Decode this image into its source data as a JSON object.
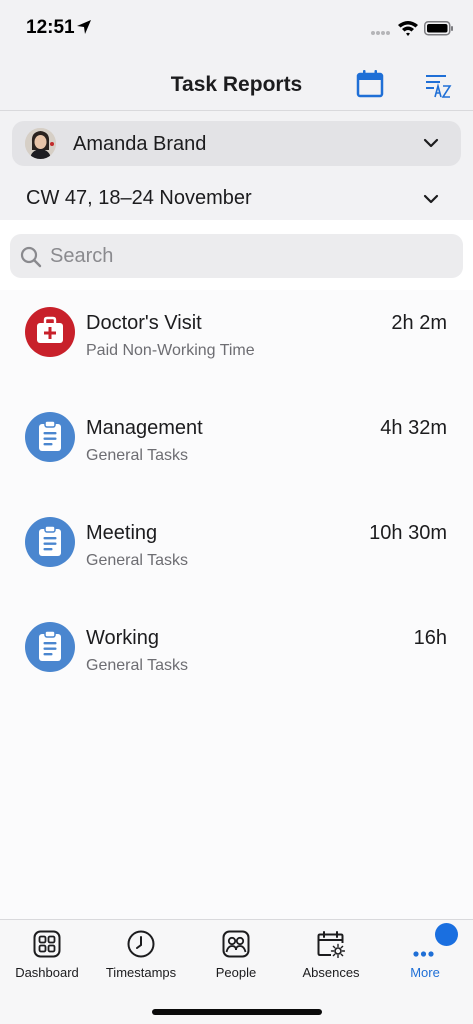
{
  "status_bar": {
    "time": "12:51"
  },
  "nav": {
    "title": "Task Reports"
  },
  "filters": {
    "person_name": "Amanda Brand",
    "week_label": "CW 47,  18–24 November"
  },
  "search": {
    "placeholder": "Search",
    "value": ""
  },
  "items": [
    {
      "title": "Doctor's Visit",
      "subtitle": "Paid Non-Working Time",
      "duration": "2h 2m",
      "icon": "medical-bag-icon",
      "color": "#c8202a"
    },
    {
      "title": "Management",
      "subtitle": "General Tasks",
      "duration": "4h 32m",
      "icon": "clipboard-icon",
      "color": "#4a86cf"
    },
    {
      "title": "Meeting",
      "subtitle": "General Tasks",
      "duration": "10h 30m",
      "icon": "clipboard-icon",
      "color": "#4a86cf"
    },
    {
      "title": "Working",
      "subtitle": "General Tasks",
      "duration": "16h",
      "icon": "clipboard-icon",
      "color": "#4a86cf"
    }
  ],
  "tabs": [
    {
      "label": "Dashboard",
      "icon": "dashboard-grid-icon"
    },
    {
      "label": "Timestamps",
      "icon": "clock-icon"
    },
    {
      "label": "People",
      "icon": "people-icon"
    },
    {
      "label": "Absences",
      "icon": "calendar-sun-icon"
    },
    {
      "label": "More",
      "icon": "more-dots-icon",
      "active": true
    }
  ],
  "colors": {
    "accent": "#1f6fd6",
    "badge": "#1a6fe0"
  }
}
